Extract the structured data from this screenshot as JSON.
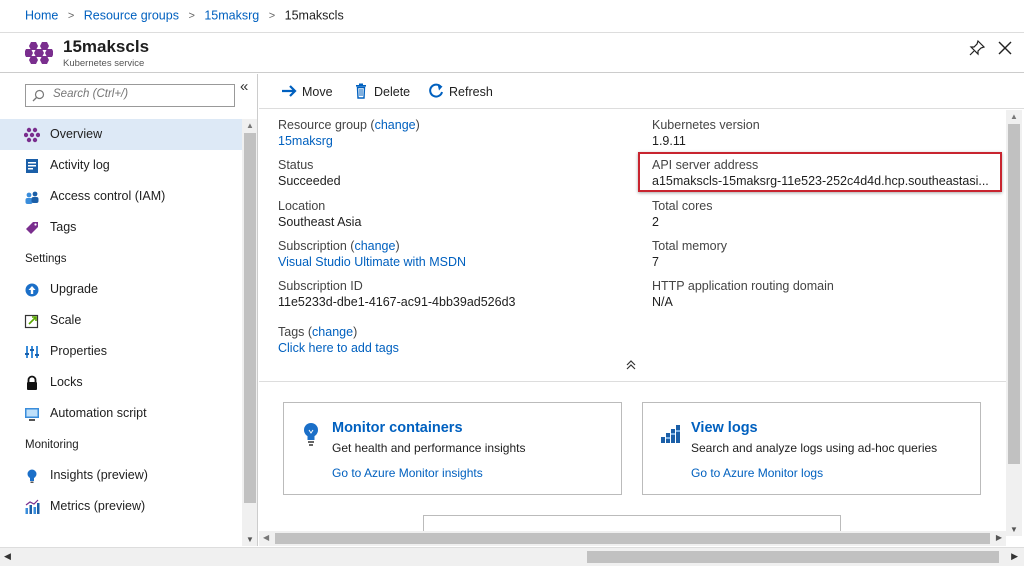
{
  "breadcrumb": {
    "items": [
      "Home",
      "Resource groups",
      "15maksrg"
    ],
    "current": "15makscls",
    "separator": ">"
  },
  "resource": {
    "name": "15makscls",
    "type": "Kubernetes service"
  },
  "search": {
    "placeholder": "Search (Ctrl+/)",
    "collapse": "«"
  },
  "menu": {
    "items": [
      {
        "label": "Overview",
        "icon": "kubernetes-icon",
        "active": true
      },
      {
        "label": "Activity log",
        "icon": "activity-log-icon"
      },
      {
        "label": "Access control (IAM)",
        "icon": "people-icon"
      },
      {
        "label": "Tags",
        "icon": "tag-icon"
      }
    ],
    "sections": [
      {
        "title": "Settings",
        "items": [
          {
            "label": "Upgrade",
            "icon": "upgrade-icon"
          },
          {
            "label": "Scale",
            "icon": "scale-icon"
          },
          {
            "label": "Properties",
            "icon": "properties-icon"
          },
          {
            "label": "Locks",
            "icon": "lock-icon"
          },
          {
            "label": "Automation script",
            "icon": "automation-script-icon"
          }
        ]
      },
      {
        "title": "Monitoring",
        "items": [
          {
            "label": "Insights (preview)",
            "icon": "insights-icon"
          },
          {
            "label": "Metrics (preview)",
            "icon": "metrics-icon"
          }
        ]
      }
    ]
  },
  "toolbar": {
    "move": "Move",
    "delete": "Delete",
    "refresh": "Refresh"
  },
  "essentials": {
    "resource_group_label": "Resource group",
    "change": "change",
    "resource_group_value": "15maksrg",
    "status_label": "Status",
    "status_value": "Succeeded",
    "location_label": "Location",
    "location_value": "Southeast Asia",
    "subscription_label": "Subscription",
    "subscription_value": "Visual Studio Ultimate with MSDN",
    "subscription_id_label": "Subscription ID",
    "subscription_id_value": "11e5233d-dbe1-4167-ac91-4bb39ad526d3",
    "tags_label": "Tags",
    "tags_link": "Click here to add tags",
    "k8s_version_label": "Kubernetes version",
    "k8s_version_value": "1.9.11",
    "api_label": "API server address",
    "api_value": "a15makscls-15maksrg-11e523-252c4d4d.hcp.southeastasi...",
    "cores_label": "Total cores",
    "cores_value": "2",
    "memory_label": "Total memory",
    "memory_value": "7",
    "http_label": "HTTP application routing domain",
    "http_value": "N/A"
  },
  "cards": [
    {
      "title": "Monitor containers",
      "desc": "Get health and performance insights",
      "link": "Go to Azure Monitor insights",
      "icon": "lightbulb-icon"
    },
    {
      "title": "View logs",
      "desc": "Search and analyze logs using ad-hoc queries",
      "link": "Go to Azure Monitor logs",
      "icon": "logs-icon"
    }
  ],
  "colors": {
    "link": "#0060bf",
    "highlight": "#c8242f",
    "active_menu": "#dde9f6"
  }
}
